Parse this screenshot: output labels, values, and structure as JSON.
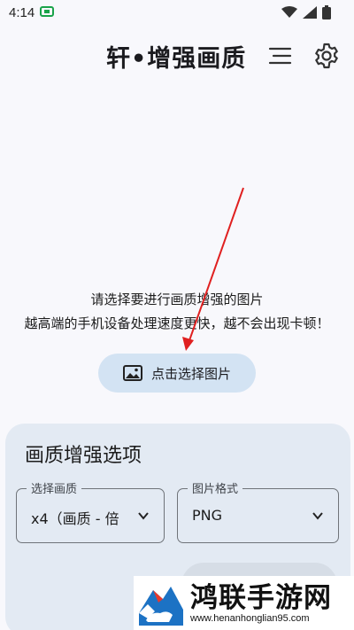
{
  "status_bar": {
    "time": "4:14"
  },
  "app_bar": {
    "title": "轩•增强画质"
  },
  "hint": {
    "line1": "请选择要进行画质增强的图片",
    "line2": "越高端的手机设备处理速度更快，越不会出现卡顿！"
  },
  "pick_button": {
    "label": "点击选择图片",
    "icon": "image-icon"
  },
  "options_panel": {
    "title": "画质增强选项",
    "quality": {
      "label": "选择画质",
      "value": "x4（画质 - 倍"
    },
    "format": {
      "label": "图片格式",
      "value": "PNG"
    }
  },
  "watermark": {
    "name": "鸿联手游网",
    "url": "www.henanhonglian95.com"
  },
  "colors": {
    "accent_button": "#d3e3f3",
    "panel_bg": "#e3eaf3",
    "arrow": "#e02020"
  }
}
